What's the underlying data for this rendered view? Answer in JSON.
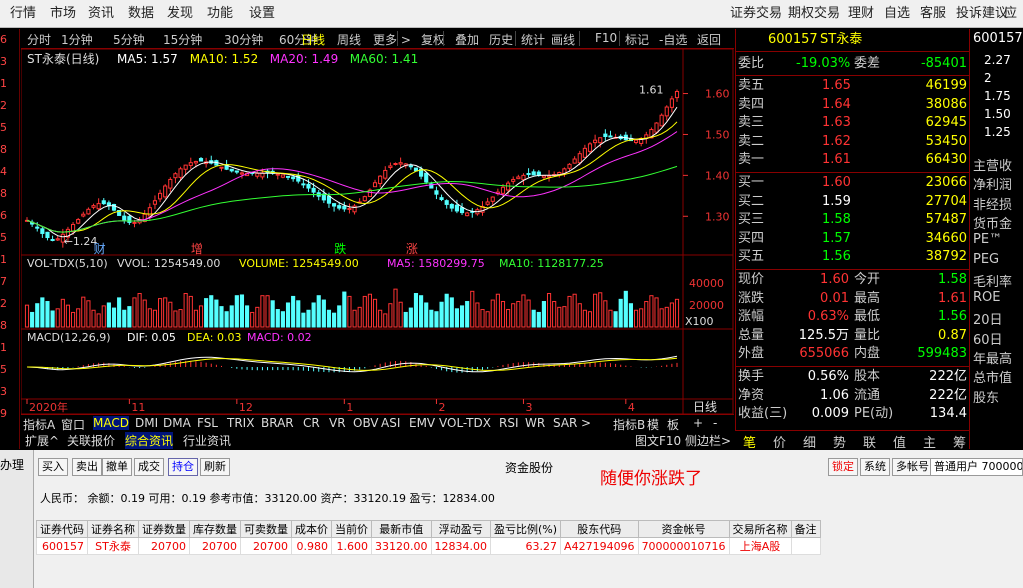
{
  "menubar": {
    "left": [
      "行情",
      "市场",
      "资讯",
      "数据",
      "发现",
      "功能",
      "设置"
    ],
    "right": [
      "证券交易",
      "期权交易",
      "理财",
      "自选",
      "客服",
      "投诉建议",
      "应"
    ]
  },
  "left_strip": [
    "6",
    "3",
    "1",
    "2",
    "5",
    "8",
    "4",
    "8",
    "6",
    "5",
    "1",
    "7",
    "2",
    "8",
    "1",
    "5",
    "3",
    "9"
  ],
  "toolbar": {
    "items": [
      "分时",
      "1分钟",
      "5分钟",
      "15分钟",
      "30分钟",
      "60分钟",
      "日线",
      "周线",
      "更多 >",
      "复权",
      "叠加",
      "历史",
      "统计",
      "画线",
      "F10",
      "标记",
      "-自选",
      "返回"
    ],
    "active": "日线"
  },
  "chart_data": {
    "type": "candlestick",
    "main": {
      "title": "ST永泰(日线)",
      "indicators": [
        {
          "name": "MA5",
          "value": "1.57",
          "color": "#ffffff"
        },
        {
          "name": "MA10",
          "value": "1.52",
          "color": "#ffff00"
        },
        {
          "name": "MA20",
          "value": "1.49",
          "color": "#ff33ff"
        },
        {
          "name": "MA60",
          "value": "1.41",
          "color": "#33ff33"
        }
      ],
      "y_ticks": [
        "1.60",
        "1.50",
        "1.40",
        "1.30"
      ],
      "ylim": [
        1.22,
        1.66
      ],
      "high_label": "1.61",
      "low_label": "1.24",
      "markers": [
        {
          "text": "财",
          "color": "#6af",
          "index": 14
        },
        {
          "text": "增",
          "color": "#f44",
          "index": 33
        },
        {
          "text": "跌",
          "color": "#0f0",
          "index": 61
        },
        {
          "text": "涨",
          "color": "#f44",
          "index": 75
        }
      ]
    },
    "volume": {
      "title": "VOL-TDX(5,10)",
      "vvol": "VVOL: 1254549.00",
      "volume": "VOLUME: 1254549.00",
      "ma5": "MA5: 1580299.75",
      "ma10": "MA10: 1128177.25",
      "y_ticks": [
        "40000",
        "20000"
      ],
      "unit": "X100"
    },
    "macd": {
      "title": "MACD(12,26,9)",
      "dif": "DIF: 0.05",
      "dea": "DEA: 0.03",
      "macd": "MACD: 0.02"
    },
    "x_ticks": [
      "2020年",
      "11",
      "12",
      "1",
      "2",
      "3",
      "4"
    ],
    "x_tick_idx": [
      0,
      20,
      41,
      62,
      80,
      97,
      117
    ],
    "x_right_label": "日线",
    "n": 128,
    "start": 1.29,
    "close": [
      1.29,
      1.281,
      1.271,
      1.258,
      1.248,
      1.241,
      1.245,
      1.256,
      1.268,
      1.28,
      1.292,
      1.305,
      1.317,
      1.326,
      1.331,
      1.331,
      1.326,
      1.315,
      1.302,
      1.291,
      1.285,
      1.285,
      1.292,
      1.305,
      1.321,
      1.338,
      1.356,
      1.374,
      1.39,
      1.404,
      1.416,
      1.425,
      1.431,
      1.434,
      1.435,
      1.433,
      1.43,
      1.425,
      1.42,
      1.415,
      1.411,
      1.408,
      1.406,
      1.405,
      1.405,
      1.405,
      1.406,
      1.406,
      1.405,
      1.403,
      1.401,
      1.397,
      1.392,
      1.386,
      1.378,
      1.369,
      1.359,
      1.349,
      1.34,
      1.332,
      1.325,
      1.32,
      1.318,
      1.319,
      1.325,
      1.335,
      1.348,
      1.364,
      1.382,
      1.398,
      1.412,
      1.423,
      1.429,
      1.431,
      1.428,
      1.421,
      1.411,
      1.398,
      1.384,
      1.369,
      1.354,
      1.341,
      1.329,
      1.32,
      1.313,
      1.309,
      1.308,
      1.31,
      1.316,
      1.324,
      1.335,
      1.347,
      1.359,
      1.371,
      1.381,
      1.39,
      1.396,
      1.4,
      1.402,
      1.401,
      1.4,
      1.399,
      1.399,
      1.402,
      1.407,
      1.416,
      1.427,
      1.44,
      1.453,
      1.466,
      1.477,
      1.486,
      1.492,
      1.495,
      1.495,
      1.493,
      1.49,
      1.487,
      1.485,
      1.486,
      1.49,
      1.499,
      1.512,
      1.528,
      1.547,
      1.567,
      1.587,
      1.605
    ],
    "volume_values": [
      0.3,
      0.2,
      0.32,
      0.4,
      0.35,
      0.22,
      0.25,
      0.38,
      0.3,
      0.2,
      0.25,
      0.41,
      0.36,
      0.23,
      0.18,
      0.29,
      0.33,
      0.26,
      0.4,
      0.23,
      0.28,
      0.4,
      0.46,
      0.37,
      0.25,
      0.23,
      0.39,
      0.4,
      0.34,
      0.22,
      0.24,
      0.46,
      0.42,
      0.23,
      0.29,
      0.39,
      0.43,
      0.37,
      0.28,
      0.21,
      0.29,
      0.43,
      0.44,
      0.29,
      0.2,
      0.27,
      0.43,
      0.43,
      0.36,
      0.24,
      0.21,
      0.33,
      0.42,
      0.36,
      0.19,
      0.23,
      0.33,
      0.43,
      0.37,
      0.23,
      0.19,
      0.29,
      0.48,
      0.42,
      0.23,
      0.27,
      0.42,
      0.45,
      0.38,
      0.23,
      0.18,
      0.32,
      0.52,
      0.34,
      0.2,
      0.26,
      0.46,
      0.43,
      0.33,
      0.23,
      0.21,
      0.34,
      0.45,
      0.4,
      0.25,
      0.29,
      0.35,
      0.49,
      0.33,
      0.24,
      0.21,
      0.37,
      0.45,
      0.35,
      0.24,
      0.32,
      0.35,
      0.44,
      0.37,
      0.23,
      0.2,
      0.35,
      0.46,
      0.35,
      0.27,
      0.28,
      0.42,
      0.45,
      0.32,
      0.23,
      0.21,
      0.45,
      0.47,
      0.36,
      0.23,
      0.21,
      0.38,
      0.49,
      0.32,
      0.23,
      0.25,
      0.35,
      0.43,
      0.4,
      0.25,
      0.27,
      0.33,
      0.38
    ]
  },
  "bottom_tabs": {
    "row1": [
      "指标A",
      "窗口",
      "MACD",
      "DMI",
      "DMA",
      "FSL",
      "TRIX",
      "BRAR",
      "CR",
      "VR",
      "OBV",
      "ASI",
      "EMV",
      "VOL-TDX",
      "RSI",
      "WR",
      "SAR",
      ">",
      "指标B",
      "模",
      "板",
      "+",
      "-"
    ],
    "row1_active": "MACD",
    "row2": [
      "扩展^",
      "关联报价",
      "综合资讯",
      "行业资讯"
    ],
    "row2_active": "综合资讯",
    "row2_right": [
      "图文F10",
      "侧边栏>"
    ]
  },
  "quote": {
    "code": "600157",
    "name": "ST永泰",
    "webi_label": "委比",
    "webi": "-19.03%",
    "weicha_label": "委差",
    "weicha": "-85401",
    "sells": [
      {
        "label": "卖五",
        "price": "1.65",
        "vol": "46199"
      },
      {
        "label": "卖四",
        "price": "1.64",
        "vol": "38086"
      },
      {
        "label": "卖三",
        "price": "1.63",
        "vol": "62945"
      },
      {
        "label": "卖二",
        "price": "1.62",
        "vol": "53450"
      },
      {
        "label": "卖一",
        "price": "1.61",
        "vol": "66430"
      }
    ],
    "buys": [
      {
        "label": "买一",
        "price": "1.60",
        "vol": "23066"
      },
      {
        "label": "买二",
        "price": "1.59",
        "vol": "27704"
      },
      {
        "label": "买三",
        "price": "1.58",
        "vol": "57487"
      },
      {
        "label": "买四",
        "price": "1.57",
        "vol": "34660"
      },
      {
        "label": "买五",
        "price": "1.56",
        "vol": "38792"
      }
    ],
    "stats": [
      {
        "l1": "现价",
        "v1": "1.60",
        "c1": "r",
        "l2": "今开",
        "v2": "1.58",
        "c2": "g"
      },
      {
        "l1": "涨跌",
        "v1": "0.01",
        "c1": "r",
        "l2": "最高",
        "v2": "1.61",
        "c2": "r"
      },
      {
        "l1": "涨幅",
        "v1": "0.63%",
        "c1": "r",
        "l2": "最低",
        "v2": "1.56",
        "c2": "g"
      },
      {
        "l1": "总量",
        "v1": "125.5万",
        "c1": "w",
        "l2": "量比",
        "v2": "0.87",
        "c2": "y"
      },
      {
        "l1": "外盘",
        "v1": "655066",
        "c1": "r",
        "l2": "内盘",
        "v2": "599483",
        "c2": "g"
      }
    ],
    "stats2": [
      {
        "l1": "换手",
        "v1": "0.56%",
        "l2": "股本",
        "v2": "222亿"
      },
      {
        "l1": "净资",
        "v1": "1.06",
        "l2": "流通",
        "v2": "222亿"
      },
      {
        "l1": "收益(三)",
        "v1": "0.009",
        "l2": "PE(动)",
        "v2": "134.4"
      }
    ],
    "bottom_tabs": [
      "笔",
      "价",
      "细",
      "势",
      "联",
      "值",
      "主",
      "筹"
    ]
  },
  "right_col": {
    "code": "600157",
    "prices": [
      "2.27",
      "2",
      "1.75",
      "1.50",
      "1.25"
    ],
    "labels": [
      "主营收",
      "净利润",
      "非经损",
      "货币金",
      "PE™",
      "PEG",
      "毛利率",
      "ROE",
      "20日",
      "60日",
      "年最高",
      "总市值",
      "股东"
    ]
  },
  "trade": {
    "left_label": "办理",
    "buttons": [
      "买入",
      "卖出",
      "撤单",
      "成交",
      "持仓",
      "刷新"
    ],
    "active_button": "持仓",
    "title": "资金股份",
    "slogan": "随便你涨跌了",
    "right_buttons": [
      "锁定",
      "系统",
      "多帐号"
    ],
    "user_select": "普通用户 700000",
    "summary": "人民币：  余额：0.19    可用：0.19    参考市值：33120.00    资产：33120.19    盈亏：12834.00",
    "columns": [
      "证券代码",
      "证券名称",
      "证券数量",
      "库存数量",
      "可卖数量",
      "成本价",
      "当前价",
      "最新市值",
      "浮动盈亏",
      "盈亏比例(%)",
      "股东代码",
      "资金帐号",
      "交易所名称",
      "备注"
    ],
    "rows": [
      [
        "600157",
        "ST永泰",
        "20700",
        "20700",
        "20700",
        "0.980",
        "1.600",
        "33120.00",
        "12834.00",
        "63.27",
        "A427194096",
        "700000010716",
        "上海A股",
        ""
      ]
    ]
  }
}
